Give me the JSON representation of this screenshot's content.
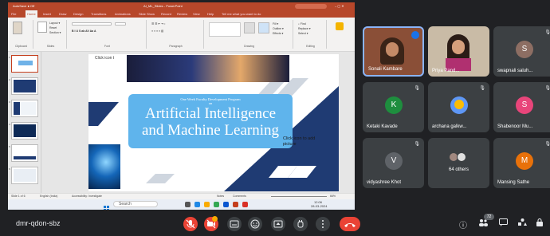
{
  "ppt": {
    "title": "AI_ML_Slides - PowerPoint",
    "tabs": [
      "File",
      "Home",
      "Insert",
      "Draw",
      "Design",
      "Transitions",
      "Animations",
      "Slide Show",
      "Record",
      "Review",
      "View",
      "Help"
    ],
    "search_hint": "Tell me what you want to do",
    "groups": [
      "Clipboard",
      "Slides",
      "Font",
      "Paragraph",
      "Drawing",
      "Editing"
    ],
    "slide_numbers": [
      "1",
      "2",
      "3",
      "4",
      "5",
      "6"
    ],
    "status_left": "Slide 1 of 6",
    "status_lang": "English (India)",
    "status_access": "Accessibility: Investigate",
    "status_notes": "Notes",
    "status_comments": "Comments",
    "zoom": "66%"
  },
  "slide": {
    "program": "One Week Faculty Development Program",
    "on": "on",
    "title_line1": "Artificial Intelligence",
    "title_line2": "and Machine Learning",
    "overflow_text": "Click icon to add picture",
    "click_icon": "Click icon t"
  },
  "taskbar": {
    "search": "Search",
    "time": "12:06",
    "date": "28-03-2024"
  },
  "participants": [
    {
      "name": "Sonali Kambare",
      "initial": "",
      "color": "#000000",
      "video": true
    },
    {
      "name": "Priya Pand...",
      "initial": "",
      "color": "#000000",
      "video": true
    },
    {
      "name": "swapnali saluh...",
      "initial": "S",
      "color": "#8d6e63",
      "video": false
    },
    {
      "name": "Ketaki Kavade",
      "initial": "K",
      "color": "#1e8e3e",
      "video": false
    },
    {
      "name": "archana galkw...",
      "initial": "",
      "color": "#5e97f6",
      "video": false
    },
    {
      "name": "Shabenoor Mu...",
      "initial": "S",
      "color": "#e8457a",
      "video": false
    },
    {
      "name": "vidyashree Khot",
      "initial": "V",
      "color": "#5f6368",
      "video": false
    },
    {
      "name": "64 others",
      "initial": "",
      "color": "#3c4043",
      "video": false
    },
    {
      "name": "Mansing Sathe",
      "initial": "M",
      "color": "#e8710a",
      "video": false
    }
  ],
  "meeting": {
    "code": "dmr-qdon-sbz",
    "people_count": "72"
  }
}
